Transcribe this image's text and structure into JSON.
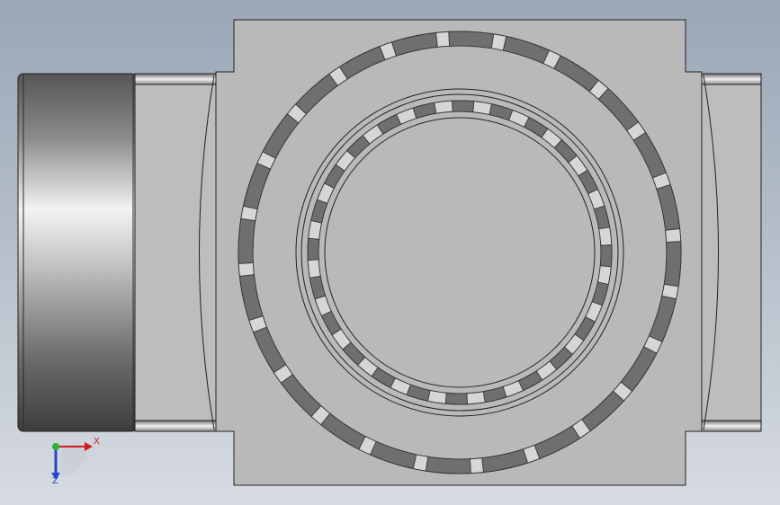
{
  "viewport": {
    "background_top": "#9aa7b7",
    "background_bottom": "#d7dbe2"
  },
  "part": {
    "face_color": "#b9b9b9",
    "outline_color": "#222222",
    "segment_dark": "#6f6f6f",
    "segment_light": "#d6d6d6"
  },
  "triad": {
    "x_label": "X",
    "z_label": "Z",
    "x_color": "#d21c1c",
    "y_color": "#2fb02f",
    "z_color": "#2a43c8"
  }
}
